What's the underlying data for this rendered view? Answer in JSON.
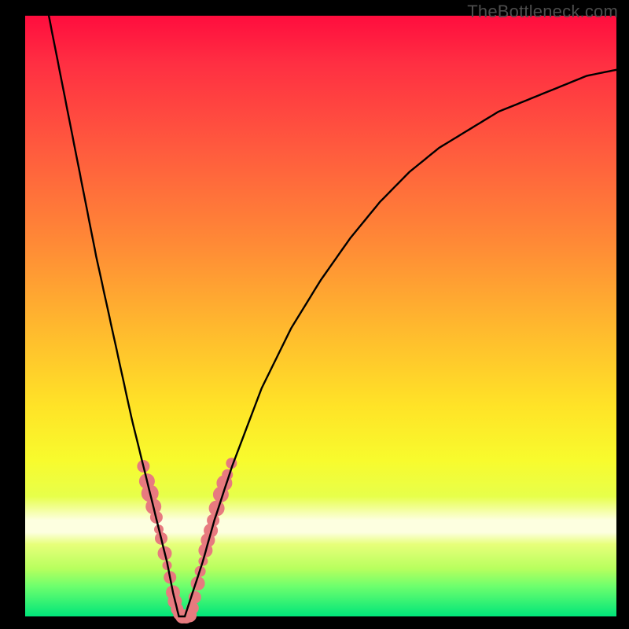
{
  "watermark": "TheBottleneck.com",
  "colors": {
    "curve": "#000000",
    "marker_fill": "#e77a7f",
    "marker_stroke": "#d76167",
    "gradient_top": "#ff0d3e",
    "gradient_bottom": "#00e57a",
    "frame": "#000000"
  },
  "chart_data": {
    "type": "line",
    "title": "",
    "xlabel": "",
    "ylabel": "",
    "xlim": [
      0,
      100
    ],
    "ylim": [
      0,
      100
    ],
    "grid": false,
    "series": [
      {
        "name": "bottleneck-curve",
        "comment": "V-shaped bottleneck curve; x and y in 0–100 relative units; minimum near x≈26 y≈0",
        "x": [
          4,
          6,
          8,
          10,
          12,
          14,
          16,
          18,
          20,
          22,
          24,
          25,
          26,
          27,
          28,
          30,
          32,
          35,
          40,
          45,
          50,
          55,
          60,
          65,
          70,
          75,
          80,
          85,
          90,
          95,
          100
        ],
        "y": [
          100,
          90,
          80,
          70,
          60,
          51,
          42,
          33,
          25,
          17,
          9,
          4,
          0,
          0,
          3,
          9,
          16,
          25,
          38,
          48,
          56,
          63,
          69,
          74,
          78,
          81,
          84,
          86,
          88,
          90,
          91
        ]
      }
    ],
    "markers": {
      "comment": "salmon dot clusters on both branches near the bottom; x,y in 0–100 units, r in px",
      "points": [
        {
          "x": 20.0,
          "y": 25.0,
          "r": 8
        },
        {
          "x": 20.6,
          "y": 22.5,
          "r": 10
        },
        {
          "x": 21.1,
          "y": 20.5,
          "r": 11
        },
        {
          "x": 21.7,
          "y": 18.3,
          "r": 10
        },
        {
          "x": 22.2,
          "y": 16.5,
          "r": 8
        },
        {
          "x": 22.6,
          "y": 14.5,
          "r": 6
        },
        {
          "x": 23.0,
          "y": 13.0,
          "r": 8
        },
        {
          "x": 23.6,
          "y": 10.5,
          "r": 9
        },
        {
          "x": 24.0,
          "y": 8.5,
          "r": 6
        },
        {
          "x": 24.5,
          "y": 6.5,
          "r": 8
        },
        {
          "x": 25.0,
          "y": 4.0,
          "r": 9
        },
        {
          "x": 25.3,
          "y": 2.5,
          "r": 9
        },
        {
          "x": 25.7,
          "y": 1.2,
          "r": 8
        },
        {
          "x": 26.1,
          "y": 0.4,
          "r": 8
        },
        {
          "x": 26.6,
          "y": 0.0,
          "r": 9
        },
        {
          "x": 27.2,
          "y": 0.0,
          "r": 9
        },
        {
          "x": 27.8,
          "y": 0.2,
          "r": 9
        },
        {
          "x": 28.3,
          "y": 1.4,
          "r": 8
        },
        {
          "x": 28.7,
          "y": 3.2,
          "r": 8
        },
        {
          "x": 29.2,
          "y": 5.5,
          "r": 9
        },
        {
          "x": 29.6,
          "y": 7.5,
          "r": 7
        },
        {
          "x": 30.1,
          "y": 9.2,
          "r": 6
        },
        {
          "x": 30.5,
          "y": 11.0,
          "r": 9
        },
        {
          "x": 30.9,
          "y": 12.7,
          "r": 9
        },
        {
          "x": 31.4,
          "y": 14.3,
          "r": 9
        },
        {
          "x": 31.8,
          "y": 16.0,
          "r": 8
        },
        {
          "x": 32.4,
          "y": 18.0,
          "r": 10
        },
        {
          "x": 33.1,
          "y": 20.3,
          "r": 10
        },
        {
          "x": 33.7,
          "y": 22.2,
          "r": 10
        },
        {
          "x": 34.2,
          "y": 23.6,
          "r": 7
        },
        {
          "x": 34.9,
          "y": 25.5,
          "r": 7
        }
      ]
    }
  }
}
